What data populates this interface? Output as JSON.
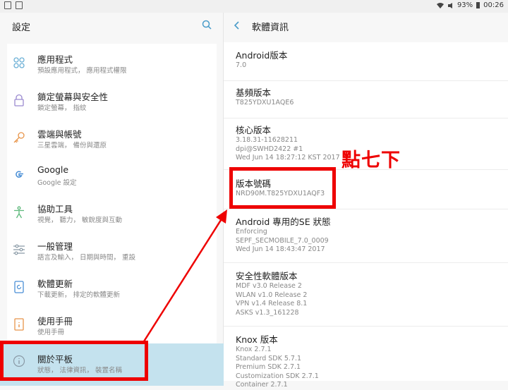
{
  "status_bar": {
    "battery": "93%",
    "time": "00:26"
  },
  "left_panel": {
    "title": "設定",
    "items": [
      {
        "icon": "apps-icon",
        "label": "應用程式",
        "sub": "預設應用程式， 應用程式權限"
      },
      {
        "icon": "lock-icon",
        "label": "鎖定螢幕與安全性",
        "sub": "鎖定螢幕， 指紋"
      },
      {
        "icon": "key-icon",
        "label": "雲端與帳號",
        "sub": "三星雲端， 備份與還原"
      },
      {
        "icon": "google-icon",
        "label": "Google",
        "sub": "Google 設定"
      },
      {
        "icon": "accessibility-icon",
        "label": "協助工具",
        "sub": "視覺， 聽力， 敏銳度與互動"
      },
      {
        "icon": "sliders-icon",
        "label": "一般管理",
        "sub": "語言及輸入， 日期與時間， 重設"
      },
      {
        "icon": "software-update-icon",
        "label": "軟體更新",
        "sub": "下載更新， 排定的軟體更新"
      },
      {
        "icon": "manual-icon",
        "label": "使用手冊",
        "sub": "使用手冊"
      },
      {
        "icon": "info-icon",
        "label": "關於平板",
        "sub": "狀態， 法律資訊， 裝置名稱"
      }
    ]
  },
  "right_panel": {
    "title": "軟體資訊",
    "entries": [
      {
        "key": "Android版本",
        "value": "7.0"
      },
      {
        "key": "基頻版本",
        "value": "T825YDXU1AQE6"
      },
      {
        "key": "核心版本",
        "value": "3.18.31-11628211\ndpi@SWHD2422 #1\nWed Jun 14 18:27:12 KST 2017"
      },
      {
        "key": "版本號碼",
        "value": "NRD90M.T825YDXU1AQF3"
      },
      {
        "key": "Android 專用的SE 狀態",
        "value": "Enforcing\nSEPF_SECMOBILE_7.0_0009\nWed Jun 14 18:43:47 2017"
      },
      {
        "key": "安全性軟體版本",
        "value": "MDF v3.0 Release 2\nWLAN v1.0 Release 2\nVPN v1.4 Release 8.1\nASKS v1.3_161228"
      },
      {
        "key": "Knox 版本",
        "value": "Knox 2.7.1\nStandard SDK 5.7.1\nPremium SDK 2.7.1\nCustomization SDK 2.7.1\nContainer 2.7.1"
      }
    ]
  },
  "annotation": {
    "note": "點七下",
    "color": "#ee0000"
  }
}
